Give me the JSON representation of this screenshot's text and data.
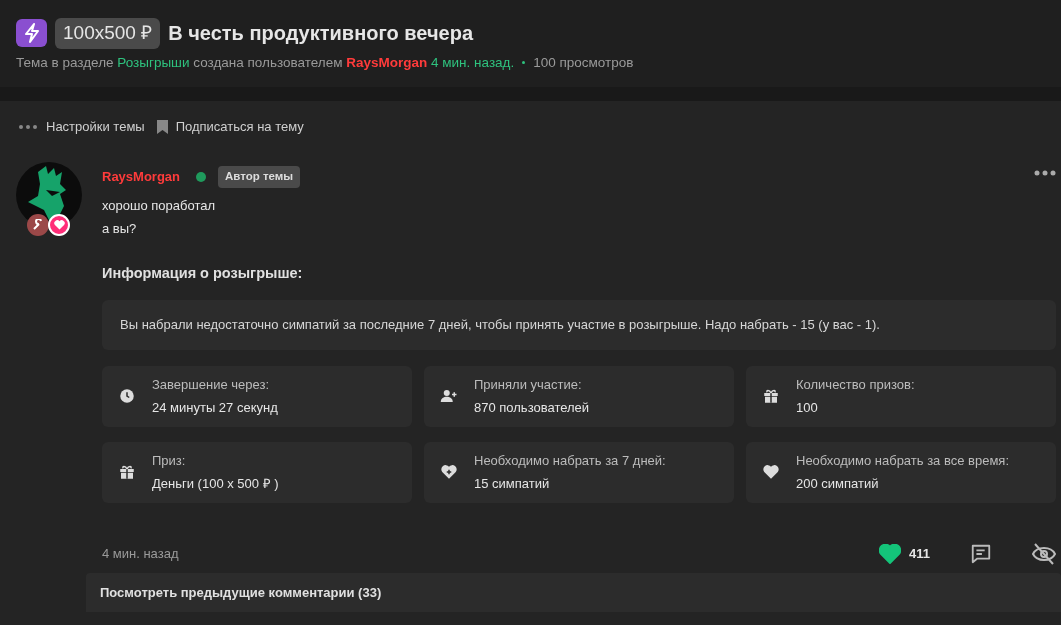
{
  "thread": {
    "prefix": "100x500 ₽",
    "title": "В честь продуктивного вечера",
    "meta": [
      {
        "kind": "plain",
        "text": "Тема в разделе"
      },
      {
        "kind": "link",
        "text": "Розыгрыши"
      },
      {
        "kind": "plain",
        "text": "создана пользователем"
      },
      {
        "kind": "user",
        "text": "RaysMorgan"
      },
      {
        "kind": "link",
        "text": "4 мин. назад."
      },
      {
        "kind": "views",
        "text": "100 просмотров"
      }
    ]
  },
  "actions": [
    {
      "kind": "dots",
      "label": "Настройки темы"
    },
    {
      "kind": "bookmark",
      "label": "Подписаться на тему"
    }
  ],
  "post": {
    "author": "RaysMorgan",
    "online": true,
    "badge": "Автор темы",
    "message": [
      "хорошо поработал",
      "а вы?"
    ],
    "info_heading": "Информация о розыгрыше:",
    "notice": "Вы набрали недостаточно симпатий за последние 7 дней, чтобы принять участие в розыгрыше. Надо набрать - 15 (у вас - 1).",
    "stats": [
      {
        "kind": "clock",
        "label": "Завершение через:",
        "value": "24 минуты 27 секунд"
      },
      {
        "kind": "user-plus",
        "label": "Приняли участие:",
        "value": "870 пользователей"
      },
      {
        "kind": "gift",
        "label": "Количество призов:",
        "value": "100"
      },
      {
        "kind": "gift",
        "label": "Приз:",
        "value": "Деньги (100 x 500 ₽ )"
      },
      {
        "kind": "heart-plus",
        "label": "Необходимо набрать за 7 дней:",
        "value": "15 симпатий"
      },
      {
        "kind": "heart",
        "label": "Необходимо набрать за все время:",
        "value": "200 симпатий"
      }
    ],
    "time": "4 мин. назад",
    "likes": "411",
    "liked": true
  },
  "comments_link": "Посмотреть предыдущие комментарии (33)"
}
